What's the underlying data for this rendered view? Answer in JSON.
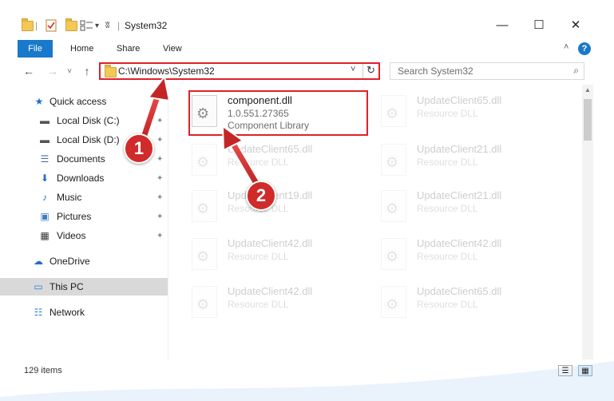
{
  "window": {
    "title": "System32",
    "min_glyph": "—",
    "max_glyph": "☐",
    "close_glyph": "✕"
  },
  "quick_access_toolbar": {
    "dropdown_glyph": "▾",
    "separator": "|"
  },
  "ribbon": {
    "tabs": [
      "File",
      "Home",
      "Share",
      "View"
    ],
    "help_glyph": "?",
    "collapse_glyph": "˄"
  },
  "navigation": {
    "back_glyph": "←",
    "forward_glyph": "→",
    "recent_glyph": "˅",
    "up_glyph": "↑"
  },
  "address_bar": {
    "path": "C:\\Windows\\System32",
    "dropdown_glyph": "˅",
    "refresh_glyph": "↻"
  },
  "search": {
    "placeholder": "Search System32",
    "icon_glyph": "⌕"
  },
  "sidebar": {
    "items": [
      {
        "label": "Quick access",
        "icon": "star-icon",
        "glyph": "★",
        "color": "#1f6fc9"
      },
      {
        "label": "Local Disk (C:)",
        "icon": "drive-icon",
        "glyph": "▬",
        "color": "#555555",
        "pin": "✦"
      },
      {
        "label": "Local Disk (D:)",
        "icon": "drive-icon",
        "glyph": "▬",
        "color": "#555555",
        "pin": "✦"
      },
      {
        "label": "Documents",
        "icon": "documents-icon",
        "glyph": "☰",
        "color": "#4a6fa5",
        "pin": "✦"
      },
      {
        "label": "Downloads",
        "icon": "download-icon",
        "glyph": "⬇",
        "color": "#1f6fc9",
        "pin": "✦"
      },
      {
        "label": "Music",
        "icon": "music-icon",
        "glyph": "♪",
        "color": "#1f6fc9",
        "pin": "✦"
      },
      {
        "label": "Pictures",
        "icon": "pictures-icon",
        "glyph": "▣",
        "color": "#3e7cc2",
        "pin": "✦"
      },
      {
        "label": "Videos",
        "icon": "videos-icon",
        "glyph": "▦",
        "color": "#333333",
        "pin": "✦"
      },
      {
        "label": "OneDrive",
        "icon": "cloud-icon",
        "glyph": "☁",
        "color": "#1f6fc9"
      },
      {
        "label": "This PC",
        "icon": "computer-icon",
        "glyph": "▭",
        "color": "#2a7fd4"
      },
      {
        "label": "Network",
        "icon": "network-icon",
        "glyph": "☷",
        "color": "#2a7fd4"
      }
    ],
    "selected": "This PC"
  },
  "files": [
    {
      "name": "component.dll",
      "line2": "1.0.551.27365",
      "line3": "Component Library",
      "faded": false
    },
    {
      "name": "UpdateClient65.dll",
      "line2": "Resource DLL",
      "line3": "",
      "faded": true
    },
    {
      "name": "UpdateClient65.dll",
      "line2": "Resource DLL",
      "line3": "",
      "faded": true
    },
    {
      "name": "UpdateClient21.dll",
      "line2": "Resource DLL",
      "line3": "",
      "faded": true
    },
    {
      "name": "UpdateClient19.dll",
      "line2": "Resource DLL",
      "line3": "",
      "faded": true
    },
    {
      "name": "UpdateClient21.dll",
      "line2": "Resource DLL",
      "line3": "",
      "faded": true
    },
    {
      "name": "UpdateClient42.dll",
      "line2": "Resource DLL",
      "line3": "",
      "faded": true
    },
    {
      "name": "UpdateClient42.dll",
      "line2": "Resource DLL",
      "line3": "",
      "faded": true
    },
    {
      "name": "UpdateClient42.dll",
      "line2": "Resource DLL",
      "line3": "",
      "faded": true
    },
    {
      "name": "UpdateClient65.dll",
      "line2": "Resource DLL",
      "line3": "",
      "faded": true
    }
  ],
  "gear_glyph": "⚙",
  "status_bar": {
    "item_count": "129 items",
    "details_view_glyph": "☰",
    "tiles_view_glyph": "▦"
  },
  "callouts": [
    "1",
    "2"
  ],
  "colors": {
    "accent": "#1979ca",
    "highlight": "#e0202a",
    "callout": "#d02a2a",
    "selected": "#d9d9d9"
  }
}
